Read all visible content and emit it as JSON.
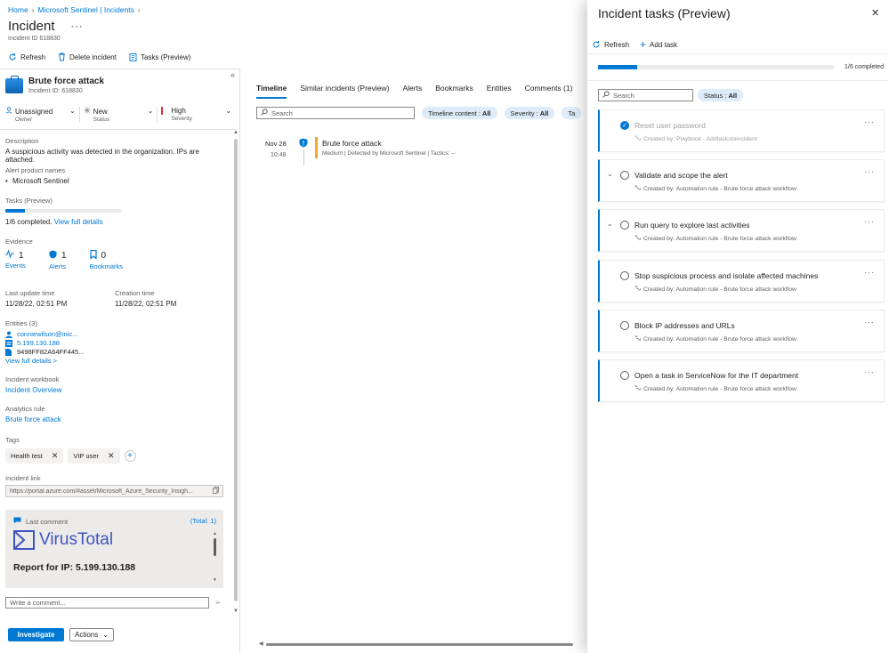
{
  "breadcrumb": [
    "Home",
    "Microsoft Sentinel | Incidents"
  ],
  "page": {
    "title": "Incident",
    "id_text": "Incident ID 618830"
  },
  "cmdbar": {
    "refresh": "Refresh",
    "delete": "Delete incident",
    "tasks": "Tasks (Preview)"
  },
  "incident": {
    "name": "Brute force attack",
    "id": "Incident ID: 618830",
    "owner": {
      "value": "Unassigned",
      "label": "Owner"
    },
    "status": {
      "value": "New",
      "label": "Status"
    },
    "severity": {
      "value": "High",
      "label": "Severity"
    },
    "description_label": "Description",
    "description": "A suspicious activity was detected in the organization. IPs are attached.",
    "alert_product_label": "Alert product names",
    "alert_product": "Microsoft Sentinel",
    "tasks_label": "Tasks (Preview)",
    "tasks_progress": 0.1667,
    "tasks_completed": "1/6 completed.",
    "view_full_details": "View full details",
    "evidence_label": "Evidence",
    "evidence": [
      {
        "count": "1",
        "label": "Events"
      },
      {
        "count": "1",
        "label": "Alerts"
      },
      {
        "count": "0",
        "label": "Bookmarks"
      }
    ],
    "last_update_label": "Last update time",
    "last_update": "11/28/22, 02:51 PM",
    "creation_label": "Creation time",
    "creation": "11/28/22, 02:51 PM",
    "entities_label": "Entities (3)",
    "entities": [
      "conniewilson@mic...",
      "5.199.130.188",
      "9498FF82A64FF445..."
    ],
    "view_full_details_entities": "View full details >",
    "workbook_label": "Incident workbook",
    "workbook": "Incident Overview",
    "analytics_label": "Analytics rule",
    "analytics": "Brute force attack",
    "tags_label": "Tags",
    "tags": [
      "Health test",
      "VIP user"
    ],
    "link_label": "Incident link",
    "link": "https://portal.azure.com/#asset/Microsoft_Azure_Security_Insigh...",
    "last_comment_label": "Last comment",
    "comment_total": "(Total: 1)",
    "comment_brand": "VirusTotal",
    "comment_report": "Report for IP: 5.199.130.188",
    "comment_placeholder": "Write a comment...",
    "investigate": "Investigate",
    "actions": "Actions"
  },
  "timeline": {
    "tabs": [
      "Timeline",
      "Similar incidents (Preview)",
      "Alerts",
      "Bookmarks",
      "Entities",
      "Comments (1)"
    ],
    "search_placeholder": "Search",
    "filters": [
      {
        "label": "Timeline content : ",
        "value": "All"
      },
      {
        "label": "Severity : ",
        "value": "All"
      },
      {
        "label": "Ta",
        "value": ""
      }
    ],
    "event": {
      "date": "Nov 28",
      "time": "10:48",
      "title": "Brute force attack",
      "subtitle": "Medium | Detected by Microsoft Sentinel | Tactics: --"
    }
  },
  "tasks_panel": {
    "title": "Incident tasks (Preview)",
    "refresh": "Refresh",
    "add_task": "Add task",
    "progress": 0.1667,
    "progress_label": "1/6 completed",
    "search_placeholder": "Search",
    "status_filter_label": "Status : ",
    "status_filter_value": "All",
    "tasks": [
      {
        "title": "Reset user password",
        "created_by": "Created by: Playbook - Addtaskstoincident",
        "done": true
      },
      {
        "title": "Validate and scope the alert",
        "created_by": "Created by: Automation rule - Brute force attack workflow",
        "done": false
      },
      {
        "title": "Run query to explore last activities",
        "created_by": "Created by: Automation rule - Brute force attack workflow",
        "done": false
      },
      {
        "title": "Stop suspicious process and isolate affected machines",
        "created_by": "Created by: Automation rule - Brute force attack workflow",
        "done": false
      },
      {
        "title": "Block IP addresses and URLs",
        "created_by": "Created by: Automation rule - Brute force attack workflow",
        "done": false
      },
      {
        "title": "Open a task in ServiceNow for the IT department",
        "created_by": "Created by: Automation rule - Brute force attack workflow",
        "done": false
      }
    ]
  },
  "colors": {
    "accent": "#0078d4",
    "severity_high": "#d13438",
    "timeline_medium": "#f7a727"
  }
}
